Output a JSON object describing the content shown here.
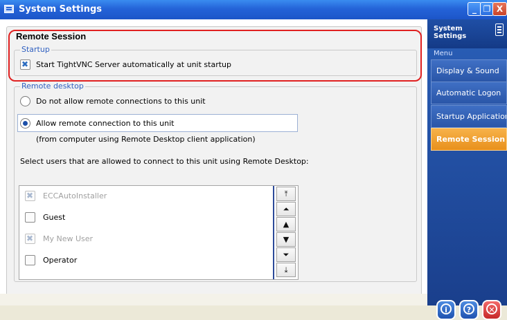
{
  "window": {
    "title": "System Settings",
    "minimize_glyph": "_",
    "maximize_glyph": "❐",
    "close_glyph": "X"
  },
  "page": {
    "title": "Remote Session"
  },
  "startup": {
    "group_label": "Startup",
    "autostart_label": "Start TightVNC Server automatically at unit startup",
    "autostart_checked": true
  },
  "remote_desktop": {
    "group_label": "Remote desktop",
    "option_deny_label": "Do not allow remote connections to this unit",
    "option_allow_label": "Allow remote connection to this unit",
    "selected_option": "allow",
    "allow_hint": "(from computer using Remote Desktop client application)",
    "users_prompt": "Select users that are allowed to connect to this unit using Remote Desktop:",
    "users": [
      {
        "name": "ECCAutoInstaller",
        "checked": true,
        "enabled": false
      },
      {
        "name": "Guest",
        "checked": false,
        "enabled": true
      },
      {
        "name": "My New User",
        "checked": true,
        "enabled": false
      },
      {
        "name": "Operator",
        "checked": false,
        "enabled": true
      }
    ]
  },
  "scroll": {
    "top_glyph": "⤒",
    "page_up_glyph": "⏶",
    "up_glyph": "▲",
    "down_glyph": "▼",
    "page_down_glyph": "⏷",
    "bottom_glyph": "⤓"
  },
  "sidebar": {
    "title": "System Settings",
    "menu_label": "Menu",
    "items": [
      {
        "label": "Display & Sound",
        "active": false
      },
      {
        "label": "Automatic Logon",
        "active": false
      },
      {
        "label": "Startup Applications",
        "active": false
      },
      {
        "label": "Remote Session",
        "active": true
      }
    ],
    "footer": {
      "info_glyph": "i",
      "help_glyph": "?",
      "exit_glyph": "✕"
    }
  },
  "colors": {
    "titlebar": "#2463d8",
    "sidebar": "#1f4fa6",
    "active_menu": "#f2a63a",
    "highlight_outline": "#e02020",
    "group_label": "#3060c0"
  }
}
